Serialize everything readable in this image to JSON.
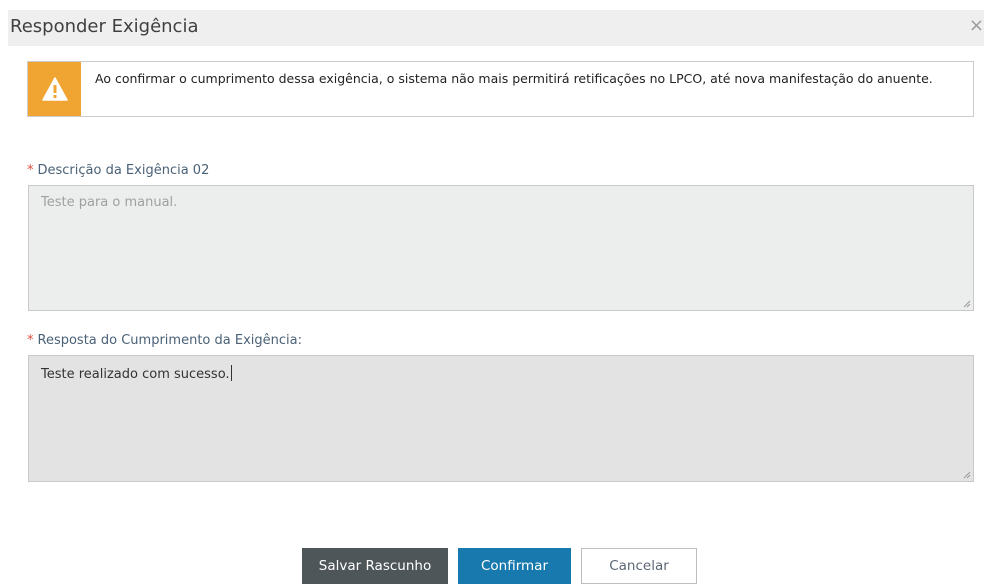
{
  "dialog": {
    "title": "Responder Exigência",
    "close_glyph": "×"
  },
  "alert": {
    "icon": "warning-icon",
    "icon_color": "#f0a431",
    "message": "Ao confirmar o cumprimento dessa exigência, o sistema não mais permitirá retificações no LPCO, até nova manifestação do anuente."
  },
  "fields": {
    "description": {
      "required_mark": "*",
      "label": "Descrição da Exigência 02",
      "value": "Teste para o manual."
    },
    "response": {
      "required_mark": "*",
      "label": "Resposta do Cumprimento da Exigência:",
      "value": "Teste realizado com sucesso."
    }
  },
  "buttons": {
    "save_draft": "Salvar Rascunho",
    "confirm": "Confirmar",
    "cancel": "Cancelar"
  },
  "colors": {
    "confirm_button": "#1779ae",
    "save_button": "#4f5659",
    "required_mark": "#e34b3b"
  }
}
